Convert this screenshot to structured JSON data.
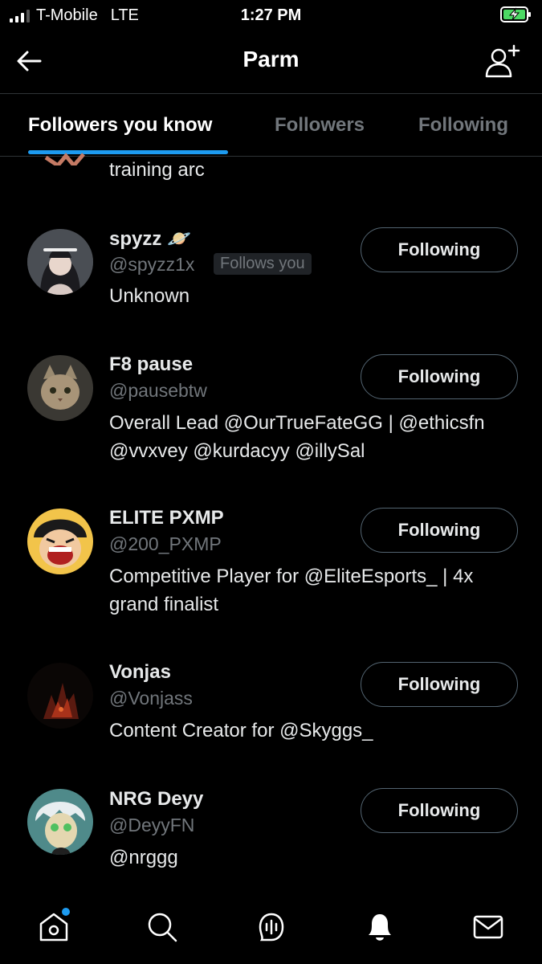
{
  "status_bar": {
    "carrier": "T-Mobile",
    "network": "LTE",
    "time": "1:27 PM",
    "battery_state": "charging"
  },
  "header": {
    "title": "Parm",
    "back_icon": "arrow-left-icon",
    "add_icon": "add-user-icon"
  },
  "tabs": [
    {
      "label": "Followers you know",
      "active": true
    },
    {
      "label": "Followers",
      "active": false
    },
    {
      "label": "Following",
      "active": false
    }
  ],
  "partial_row": {
    "bio": "training arc"
  },
  "users": [
    {
      "name": "spyzz 🪐",
      "handle": "@spyzz1x",
      "follows_you": "Follows you",
      "bio_lines": [
        "Unknown"
      ],
      "button": "Following"
    },
    {
      "name": "F8 pause",
      "handle": "@pausebtw",
      "bio_lines": [
        "Overall Lead @OurTrueFateGG | @ethicsfn",
        "@vvxvey @kurdacyy @illySal"
      ],
      "button": "Following"
    },
    {
      "name": "ELITE PXMP",
      "handle": "@200_PXMP",
      "bio_lines": [
        "Competitive Player for @EliteEsports_ | 4x",
        "grand finalist"
      ],
      "button": "Following"
    },
    {
      "name": "Vonjas",
      "handle": "@Vonjass",
      "bio_lines": [
        "Content Creator for @Skyggs_"
      ],
      "button": "Following"
    },
    {
      "name": "NRG Deyy",
      "handle": "@DeyyFN",
      "bio_lines": [
        "@nrggg"
      ],
      "button": "Following"
    }
  ],
  "bottom_nav": [
    "home-icon",
    "search-icon",
    "spaces-icon",
    "notifications-icon",
    "messages-icon"
  ],
  "colors": {
    "accent": "#1d9bf0",
    "background": "#000000",
    "secondary_text": "#71767b",
    "border": "#2f3336"
  }
}
